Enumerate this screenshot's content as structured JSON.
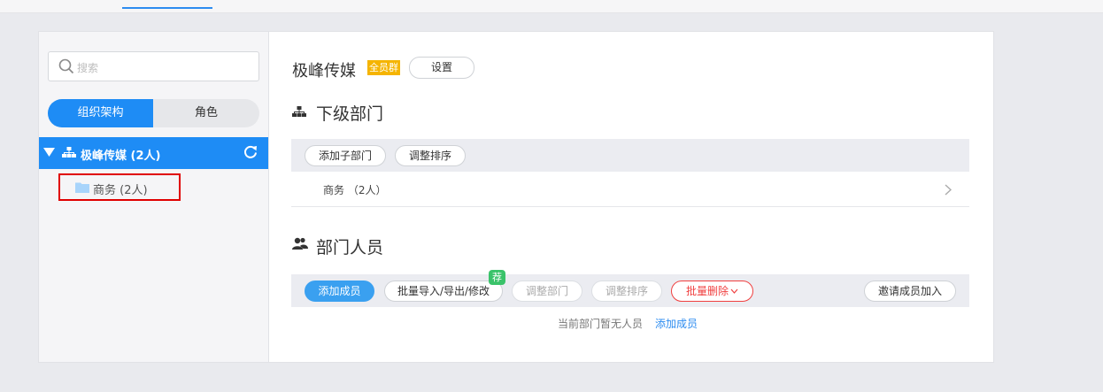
{
  "sidebar": {
    "search_placeholder": "搜索",
    "tabs": {
      "org": "组织架构",
      "role": "角色"
    },
    "tree": {
      "root_label": "极峰传媒 (2人)",
      "child_label": "商务 (2人)"
    }
  },
  "main": {
    "org_name": "极峰传媒",
    "badge": "全员群",
    "settings_label": "设置",
    "sub_section": {
      "title": "下级部门",
      "buttons": {
        "add_sub": "添加子部门",
        "sort": "调整排序"
      },
      "item_label": "商务 （2人）"
    },
    "members_section": {
      "title": "部门人员",
      "buttons": {
        "add_member": "添加成员",
        "import_export": "批量导入/导出/修改",
        "recommend_badge": "荐",
        "adjust_dept": "调整部门",
        "sort": "调整排序",
        "batch_delete": "批量删除",
        "invite": "邀请成员加入"
      },
      "empty_text": "当前部门暂无人员",
      "empty_link": "添加成员"
    }
  },
  "colors": {
    "accent": "#1e8cf5",
    "badge": "#f5b400",
    "danger": "#f04040",
    "recommend": "#3ac36a"
  }
}
